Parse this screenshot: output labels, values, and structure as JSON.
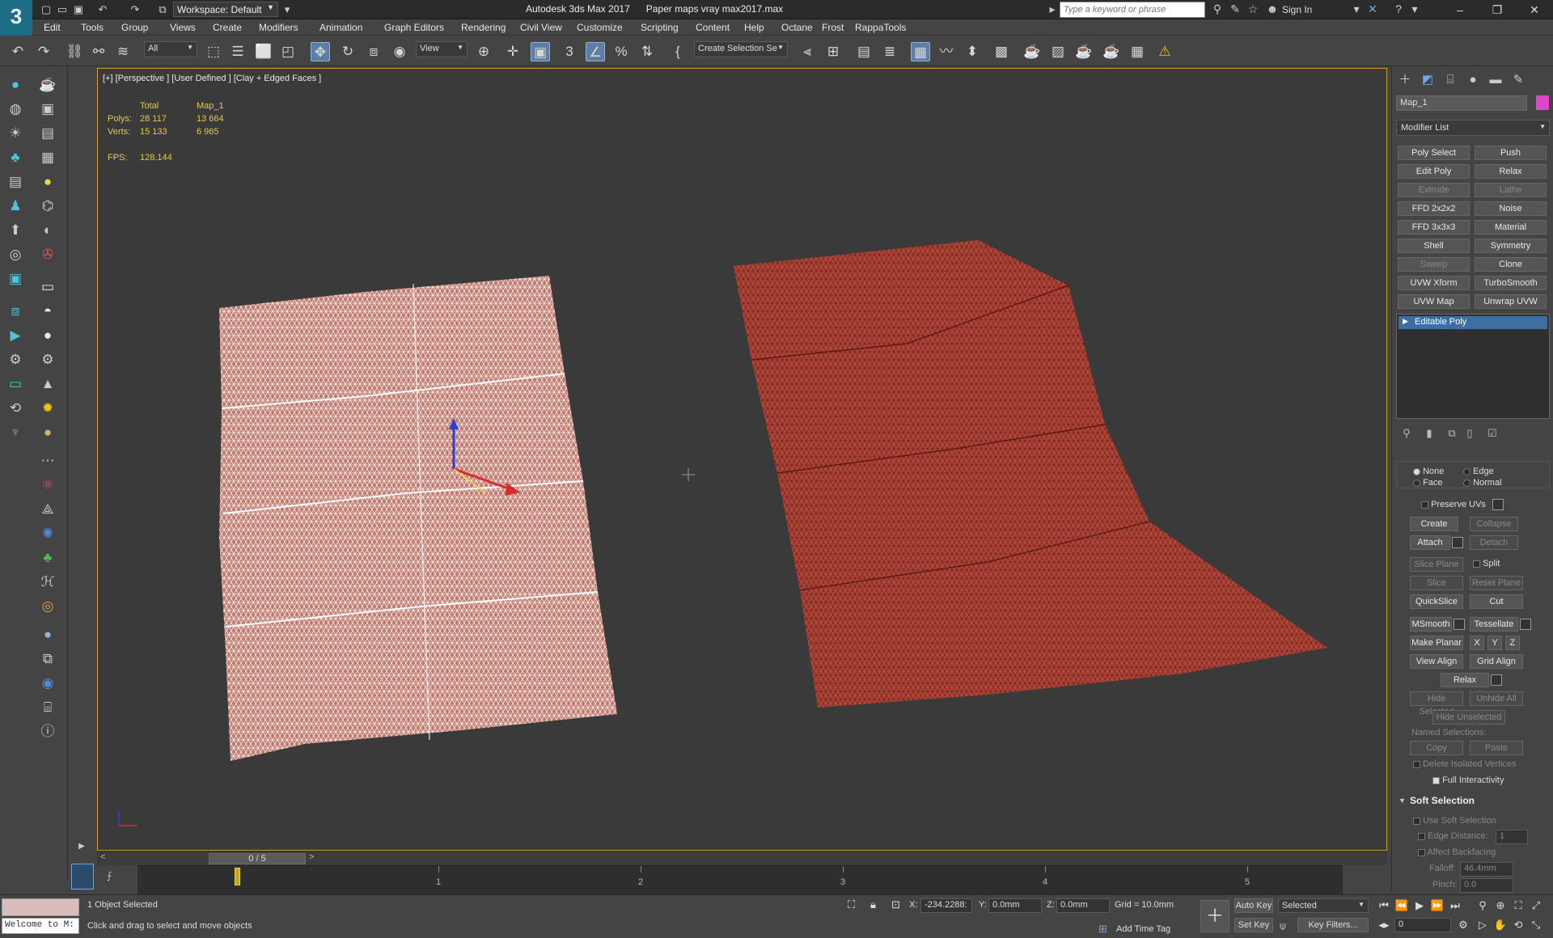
{
  "app": {
    "logo_text": "3",
    "workspace_label": "Workspace: Default",
    "title": "Autodesk 3ds Max 2017      Paper maps vray max2017.max",
    "search_placeholder": "Type a keyword or phrase",
    "sign_in": "Sign In",
    "window_controls": {
      "minimize": "–",
      "restore": "❐",
      "close": "✕"
    }
  },
  "menu": [
    "Edit",
    "Tools",
    "Group",
    "Views",
    "Create",
    "Modifiers",
    "Animation",
    "Graph Editors",
    "Rendering",
    "Civil View",
    "Customize",
    "Scripting",
    "Help",
    "Content",
    "Octane",
    "Frost",
    "RappaTools"
  ],
  "toolbar": {
    "filter_select": "All",
    "ref_coord_select": "View",
    "named_selection_select": "Create Selection Se"
  },
  "viewport": {
    "label": "[+] [Perspective ] [User Defined ] [Clay + Edged Faces ]",
    "stats": {
      "col_total": "Total",
      "col_map": "Map_1",
      "polys_label": "Polys:",
      "polys_total": "28 117",
      "polys_map": "13 664",
      "verts_label": "Verts:",
      "verts_total": "15 133",
      "verts_map": "6 965",
      "fps_label": "FPS:",
      "fps_value": "128.144"
    },
    "colors": {
      "background": "#3a3a3a",
      "mesh_left_fill": "#c07a6e",
      "mesh_left_wire": "#ffffff",
      "mesh_right_fill": "#b0463a",
      "mesh_right_wire": "#5a1a14",
      "border": "#c9a227"
    }
  },
  "time": {
    "frame_display": "0 / 5",
    "ticks": [
      "1",
      "2",
      "3",
      "4",
      "5"
    ]
  },
  "command_panel": {
    "object_name": "Map_1",
    "object_color": "#e046c8",
    "modifier_list": "Modifier List",
    "modifier_buttons": [
      {
        "label": "Poly Select",
        "enabled": true
      },
      {
        "label": "Push",
        "enabled": true
      },
      {
        "label": "Edit Poly",
        "enabled": true
      },
      {
        "label": "Relax",
        "enabled": true
      },
      {
        "label": "Extrude",
        "enabled": false
      },
      {
        "label": "Lathe",
        "enabled": false
      },
      {
        "label": "FFD 2x2x2",
        "enabled": true
      },
      {
        "label": "Noise",
        "enabled": true
      },
      {
        "label": "FFD 3x3x3",
        "enabled": true
      },
      {
        "label": "Material",
        "enabled": true
      },
      {
        "label": "Shell",
        "enabled": true
      },
      {
        "label": "Symmetry",
        "enabled": true
      },
      {
        "label": "Sweep",
        "enabled": false
      },
      {
        "label": "Clone",
        "enabled": true
      },
      {
        "label": "UVW Xform",
        "enabled": true
      },
      {
        "label": "TurboSmooth",
        "enabled": true
      },
      {
        "label": "UVW Map",
        "enabled": true
      },
      {
        "label": "Unwrap UVW",
        "enabled": true
      }
    ],
    "stack_item": "Editable Poly",
    "constraints": {
      "none": "None",
      "edge": "Edge",
      "face": "Face",
      "normal": "Normal"
    },
    "preserve_uvs": "Preserve UVs",
    "create": "Create",
    "collapse": "Collapse",
    "attach": "Attach",
    "detach": "Detach",
    "slice_plane": "Slice Plane",
    "split": "Split",
    "slice": "Slice",
    "reset_plane": "Reset Plane",
    "quickslice": "QuickSlice",
    "cut": "Cut",
    "msmooth": "MSmooth",
    "tessellate": "Tessellate",
    "make_planar": "Make Planar",
    "x": "X",
    "y": "Y",
    "z": "Z",
    "view_align": "View Align",
    "grid_align": "Grid Align",
    "relax": "Relax",
    "hide_selected": "Hide Selected",
    "unhide_all": "Unhide All",
    "hide_unselected": "Hide Unselected",
    "named_selections": "Named Selections:",
    "copy": "Copy",
    "paste": "Paste",
    "delete_isolated": "Delete Isolated Vertices",
    "full_interactivity": "Full Interactivity",
    "soft_selection": "Soft Selection",
    "use_soft_selection": "Use Soft Selection",
    "edge_distance": "Edge Distance:",
    "edge_distance_value": "1",
    "affect_backfacing": "Affect Backfacing",
    "falloff": "Falloff:",
    "falloff_value": "46.4mm",
    "pinch": "Pinch:",
    "pinch_value": "0.0"
  },
  "status": {
    "maxscript_text": "Welcome to M:",
    "selection": "1 Object Selected",
    "prompt": "Click and drag to select and move objects",
    "x_label": "X:",
    "x_value": "-234.2288:",
    "y_label": "Y:",
    "y_value": "0.0mm",
    "z_label": "Z:",
    "z_value": "0.0mm",
    "grid": "Grid = 10.0mm",
    "auto_key": "Auto Key",
    "set_key": "Set Key",
    "selected_select": "Selected",
    "key_filters": "Key Filters...",
    "add_time_tag": "Add Time Tag",
    "frame_value": "0"
  }
}
